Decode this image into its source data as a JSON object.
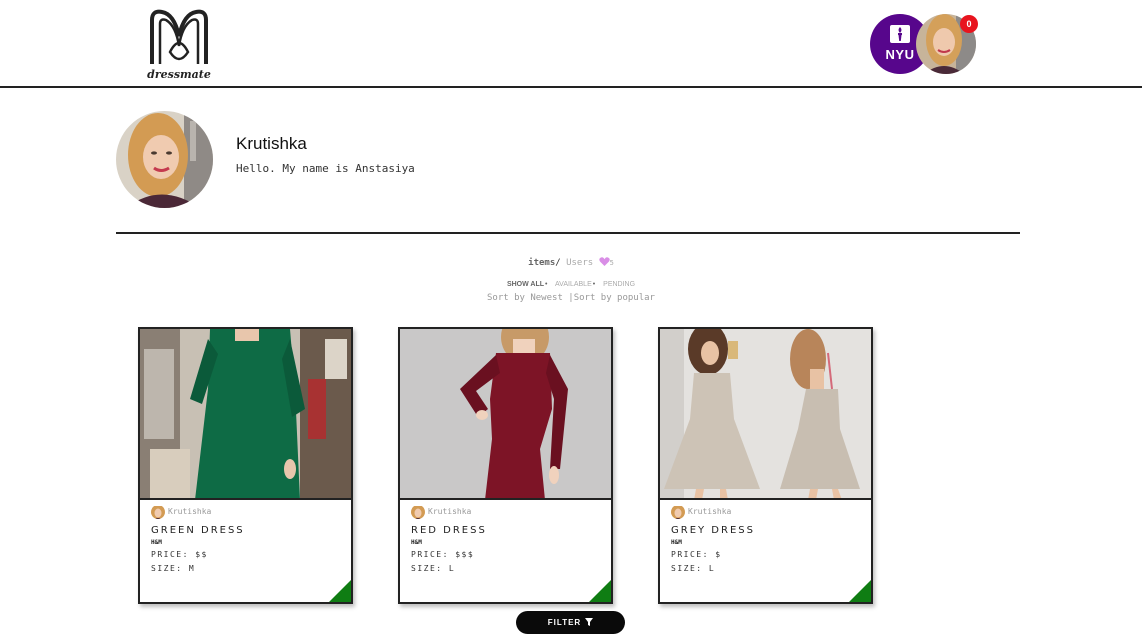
{
  "header": {
    "brand": "dressmate",
    "school_badge": "NYU",
    "notification_count": "0",
    "icons": {
      "logo": "dressmate-logo",
      "school": "nyu-torch-icon",
      "avatar": "user-avatar"
    }
  },
  "profile": {
    "name": "Krutishka",
    "bio": "Hello. My name is Anstasiya"
  },
  "tabs": {
    "items_label": "items",
    "separator": "/",
    "users_label": "Users",
    "users_count": "5"
  },
  "filters": {
    "show_all": "SHOW ALL",
    "available": "AVAILABLE",
    "pending": "PENDING",
    "dot": "•"
  },
  "sort": {
    "newest": "Sort by Newest",
    "separator": "|",
    "popular": "Sort by popular"
  },
  "items": [
    {
      "owner": "Krutishka",
      "title": "GREEN DRESS",
      "brand": "H&M",
      "price": "PRICE: $$",
      "size": "SIZE: M",
      "dress_color": "#0e6b45"
    },
    {
      "owner": "Krutishka",
      "title": "RED DRESS",
      "brand": "H&M",
      "price": "PRICE: $$$",
      "size": "SIZE: L",
      "dress_color": "#7d1426"
    },
    {
      "owner": "Krutishka",
      "title": "GREY DRESS",
      "brand": "H&M",
      "price": "PRICE: $",
      "size": "SIZE: L",
      "dress_color": "#cdc3b6"
    }
  ],
  "filter_button": {
    "label": "FILTER",
    "icon": "funnel-icon"
  },
  "colors": {
    "accent_purple": "#57068c",
    "corner_green": "#0f7d13",
    "notification_red": "#e8141e",
    "heart_pink": "#d98ee6"
  }
}
